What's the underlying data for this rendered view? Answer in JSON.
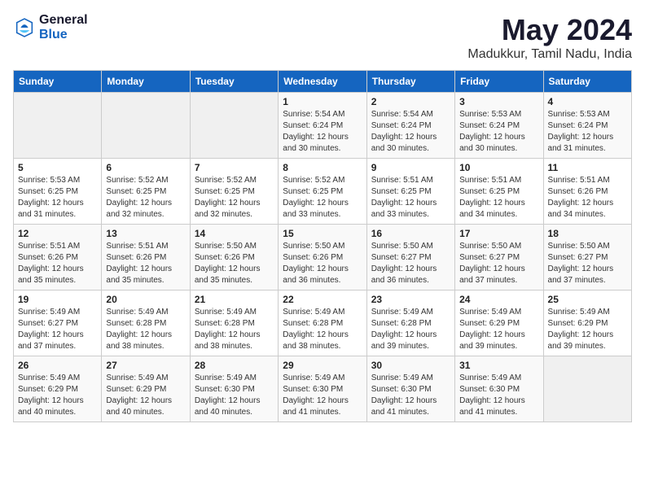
{
  "logo": {
    "general": "General",
    "blue": "Blue"
  },
  "header": {
    "title": "May 2024",
    "subtitle": "Madukkur, Tamil Nadu, India"
  },
  "weekdays": [
    "Sunday",
    "Monday",
    "Tuesday",
    "Wednesday",
    "Thursday",
    "Friday",
    "Saturday"
  ],
  "weeks": [
    [
      {
        "day": "",
        "info": ""
      },
      {
        "day": "",
        "info": ""
      },
      {
        "day": "",
        "info": ""
      },
      {
        "day": "1",
        "info": "Sunrise: 5:54 AM\nSunset: 6:24 PM\nDaylight: 12 hours\nand 30 minutes."
      },
      {
        "day": "2",
        "info": "Sunrise: 5:54 AM\nSunset: 6:24 PM\nDaylight: 12 hours\nand 30 minutes."
      },
      {
        "day": "3",
        "info": "Sunrise: 5:53 AM\nSunset: 6:24 PM\nDaylight: 12 hours\nand 30 minutes."
      },
      {
        "day": "4",
        "info": "Sunrise: 5:53 AM\nSunset: 6:24 PM\nDaylight: 12 hours\nand 31 minutes."
      }
    ],
    [
      {
        "day": "5",
        "info": "Sunrise: 5:53 AM\nSunset: 6:25 PM\nDaylight: 12 hours\nand 31 minutes."
      },
      {
        "day": "6",
        "info": "Sunrise: 5:52 AM\nSunset: 6:25 PM\nDaylight: 12 hours\nand 32 minutes."
      },
      {
        "day": "7",
        "info": "Sunrise: 5:52 AM\nSunset: 6:25 PM\nDaylight: 12 hours\nand 32 minutes."
      },
      {
        "day": "8",
        "info": "Sunrise: 5:52 AM\nSunset: 6:25 PM\nDaylight: 12 hours\nand 33 minutes."
      },
      {
        "day": "9",
        "info": "Sunrise: 5:51 AM\nSunset: 6:25 PM\nDaylight: 12 hours\nand 33 minutes."
      },
      {
        "day": "10",
        "info": "Sunrise: 5:51 AM\nSunset: 6:25 PM\nDaylight: 12 hours\nand 34 minutes."
      },
      {
        "day": "11",
        "info": "Sunrise: 5:51 AM\nSunset: 6:26 PM\nDaylight: 12 hours\nand 34 minutes."
      }
    ],
    [
      {
        "day": "12",
        "info": "Sunrise: 5:51 AM\nSunset: 6:26 PM\nDaylight: 12 hours\nand 35 minutes."
      },
      {
        "day": "13",
        "info": "Sunrise: 5:51 AM\nSunset: 6:26 PM\nDaylight: 12 hours\nand 35 minutes."
      },
      {
        "day": "14",
        "info": "Sunrise: 5:50 AM\nSunset: 6:26 PM\nDaylight: 12 hours\nand 35 minutes."
      },
      {
        "day": "15",
        "info": "Sunrise: 5:50 AM\nSunset: 6:26 PM\nDaylight: 12 hours\nand 36 minutes."
      },
      {
        "day": "16",
        "info": "Sunrise: 5:50 AM\nSunset: 6:27 PM\nDaylight: 12 hours\nand 36 minutes."
      },
      {
        "day": "17",
        "info": "Sunrise: 5:50 AM\nSunset: 6:27 PM\nDaylight: 12 hours\nand 37 minutes."
      },
      {
        "day": "18",
        "info": "Sunrise: 5:50 AM\nSunset: 6:27 PM\nDaylight: 12 hours\nand 37 minutes."
      }
    ],
    [
      {
        "day": "19",
        "info": "Sunrise: 5:49 AM\nSunset: 6:27 PM\nDaylight: 12 hours\nand 37 minutes."
      },
      {
        "day": "20",
        "info": "Sunrise: 5:49 AM\nSunset: 6:28 PM\nDaylight: 12 hours\nand 38 minutes."
      },
      {
        "day": "21",
        "info": "Sunrise: 5:49 AM\nSunset: 6:28 PM\nDaylight: 12 hours\nand 38 minutes."
      },
      {
        "day": "22",
        "info": "Sunrise: 5:49 AM\nSunset: 6:28 PM\nDaylight: 12 hours\nand 38 minutes."
      },
      {
        "day": "23",
        "info": "Sunrise: 5:49 AM\nSunset: 6:28 PM\nDaylight: 12 hours\nand 39 minutes."
      },
      {
        "day": "24",
        "info": "Sunrise: 5:49 AM\nSunset: 6:29 PM\nDaylight: 12 hours\nand 39 minutes."
      },
      {
        "day": "25",
        "info": "Sunrise: 5:49 AM\nSunset: 6:29 PM\nDaylight: 12 hours\nand 39 minutes."
      }
    ],
    [
      {
        "day": "26",
        "info": "Sunrise: 5:49 AM\nSunset: 6:29 PM\nDaylight: 12 hours\nand 40 minutes."
      },
      {
        "day": "27",
        "info": "Sunrise: 5:49 AM\nSunset: 6:29 PM\nDaylight: 12 hours\nand 40 minutes."
      },
      {
        "day": "28",
        "info": "Sunrise: 5:49 AM\nSunset: 6:30 PM\nDaylight: 12 hours\nand 40 minutes."
      },
      {
        "day": "29",
        "info": "Sunrise: 5:49 AM\nSunset: 6:30 PM\nDaylight: 12 hours\nand 41 minutes."
      },
      {
        "day": "30",
        "info": "Sunrise: 5:49 AM\nSunset: 6:30 PM\nDaylight: 12 hours\nand 41 minutes."
      },
      {
        "day": "31",
        "info": "Sunrise: 5:49 AM\nSunset: 6:30 PM\nDaylight: 12 hours\nand 41 minutes."
      },
      {
        "day": "",
        "info": ""
      }
    ]
  ]
}
